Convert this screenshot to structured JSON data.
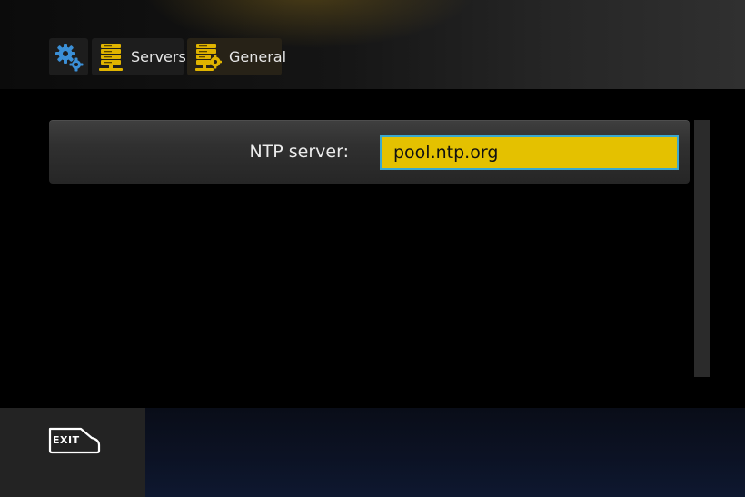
{
  "breadcrumb": {
    "items": [
      {
        "icon": "gears-icon",
        "label": ""
      },
      {
        "icon": "server-stack-icon",
        "label": "Servers"
      },
      {
        "icon": "server-settings-icon",
        "label": "General"
      }
    ]
  },
  "setting": {
    "label": "NTP server:",
    "value": "pool.ntp.org"
  },
  "footer": {
    "exit_label": "EXIT"
  },
  "colors": {
    "accent_yellow": "#e4c100",
    "focus_border": "#3aa8cf",
    "icon_blue": "#3b8fd6",
    "icon_yellow": "#e0b400"
  }
}
